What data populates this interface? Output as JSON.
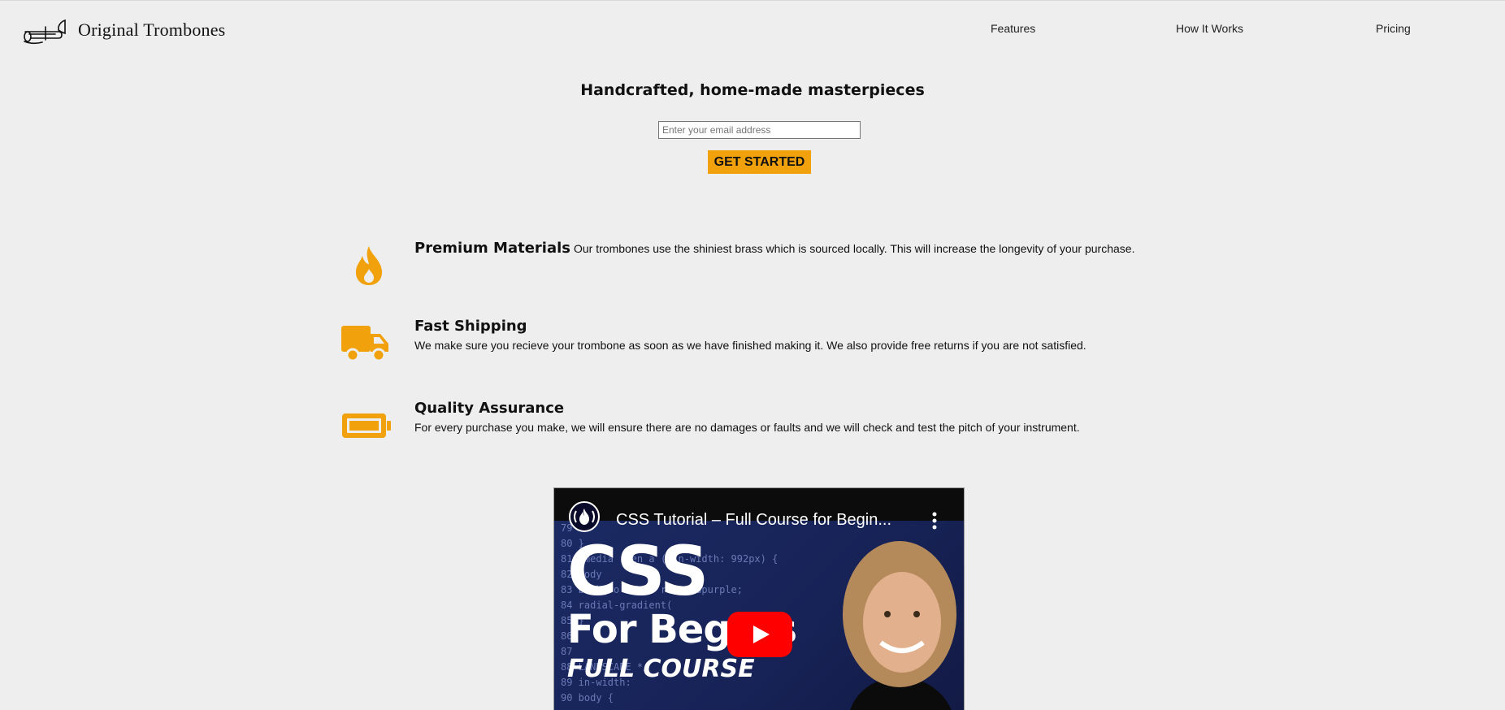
{
  "header": {
    "logo_text": "Original Trombones",
    "nav": [
      "Features",
      "How It Works",
      "Pricing"
    ]
  },
  "hero": {
    "title": "Handcrafted, home-made masterpieces",
    "email_placeholder": "Enter your email address",
    "cta_label": "GET STARTED"
  },
  "features": [
    {
      "icon": "fire-icon",
      "title": "Premium Materials",
      "description": "Our trombones use the shiniest brass which is sourced locally. This will increase the longevity of your purchase."
    },
    {
      "icon": "truck-icon",
      "title": "Fast Shipping",
      "description": "We make sure you recieve your trombone as soon as we have finished making it. We also provide free returns if you are not satisfied."
    },
    {
      "icon": "battery-icon",
      "title": "Quality Assurance",
      "description": "For every purchase you make, we will ensure there are no damages or faults and we will check and test the pitch of your instrument."
    }
  ],
  "video": {
    "title": "CSS Tutorial – Full Course for Begin...",
    "thumbnail_headline": "CSS",
    "thumbnail_subline": "For Begi    rs",
    "thumbnail_tag": "FULL COURSE",
    "code_lines": [
      "79",
      "80        }",
      "81    @media   reen a   (min-width: 992px) {",
      "82        body",
      "83          backgro  -colo    rebeccapurple;",
      "84                          radial-gradient(",
      "85        }",
      "86",
      "87",
      "88                         LANDSCAPE  */",
      "89                     in-width:",
      "90        body {"
    ]
  },
  "colors": {
    "accent": "#f1a10b",
    "background": "#eeeeee"
  }
}
